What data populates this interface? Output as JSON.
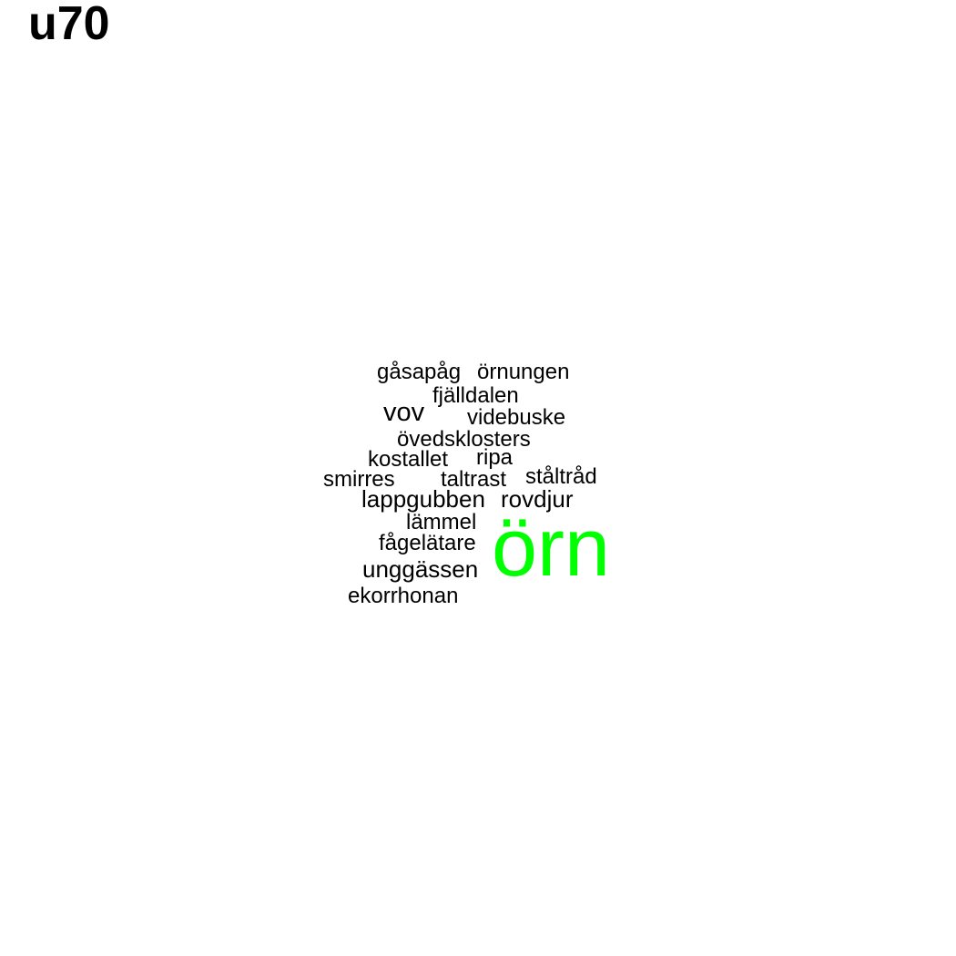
{
  "title": "u70",
  "colors": {
    "highlight": "#00ff00",
    "default": "#000000",
    "background": "#ffffff"
  },
  "words": [
    {
      "text": "gåsapåg",
      "highlight": false
    },
    {
      "text": "örnungen",
      "highlight": false
    },
    {
      "text": "fjälldalen",
      "highlight": false
    },
    {
      "text": "vov",
      "highlight": false
    },
    {
      "text": "videbuske",
      "highlight": false
    },
    {
      "text": "övedsklosters",
      "highlight": false
    },
    {
      "text": "kostallet",
      "highlight": false
    },
    {
      "text": "ripa",
      "highlight": false
    },
    {
      "text": "smirres",
      "highlight": false
    },
    {
      "text": "taltrast",
      "highlight": false
    },
    {
      "text": "ståltråd",
      "highlight": false
    },
    {
      "text": "lappgubben",
      "highlight": false
    },
    {
      "text": "rovdjur",
      "highlight": false
    },
    {
      "text": "lämmel",
      "highlight": false
    },
    {
      "text": "fågelätare",
      "highlight": false
    },
    {
      "text": "örn",
      "highlight": true
    },
    {
      "text": "unggässen",
      "highlight": false
    },
    {
      "text": "ekorrhonan",
      "highlight": false
    }
  ]
}
